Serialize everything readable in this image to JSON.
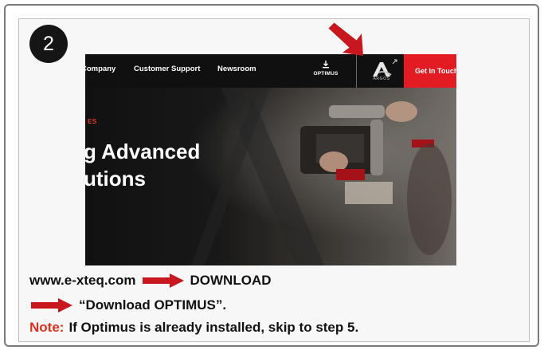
{
  "step": {
    "number": "2"
  },
  "screenshot": {
    "nav": {
      "company": "Company",
      "customer_support": "Customer Support",
      "newsroom": "Newsroom",
      "optimus_label": "OPTIMUS",
      "argos_label": "ARGOS",
      "cta": "Get In Touch"
    },
    "hero": {
      "eyebrow": "ES",
      "headline_line1": "g Advanced",
      "headline_line2": "utions"
    }
  },
  "instructions": {
    "url": "www.e-xteq.com",
    "download": "DOWNLOAD",
    "download_optimus": "“Download OPTIMUS”.",
    "note_label": "Note:",
    "note_text": "If Optimus is already installed, skip to step 5."
  },
  "colors": {
    "accent_red": "#e31b23",
    "note_red": "#e0301e",
    "arrow_red": "#c8171f",
    "nav_bg": "#101010"
  },
  "icons": [
    "download-icon",
    "argos-logo-icon",
    "pointer-arrow-icon",
    "right-arrow-icon"
  ]
}
